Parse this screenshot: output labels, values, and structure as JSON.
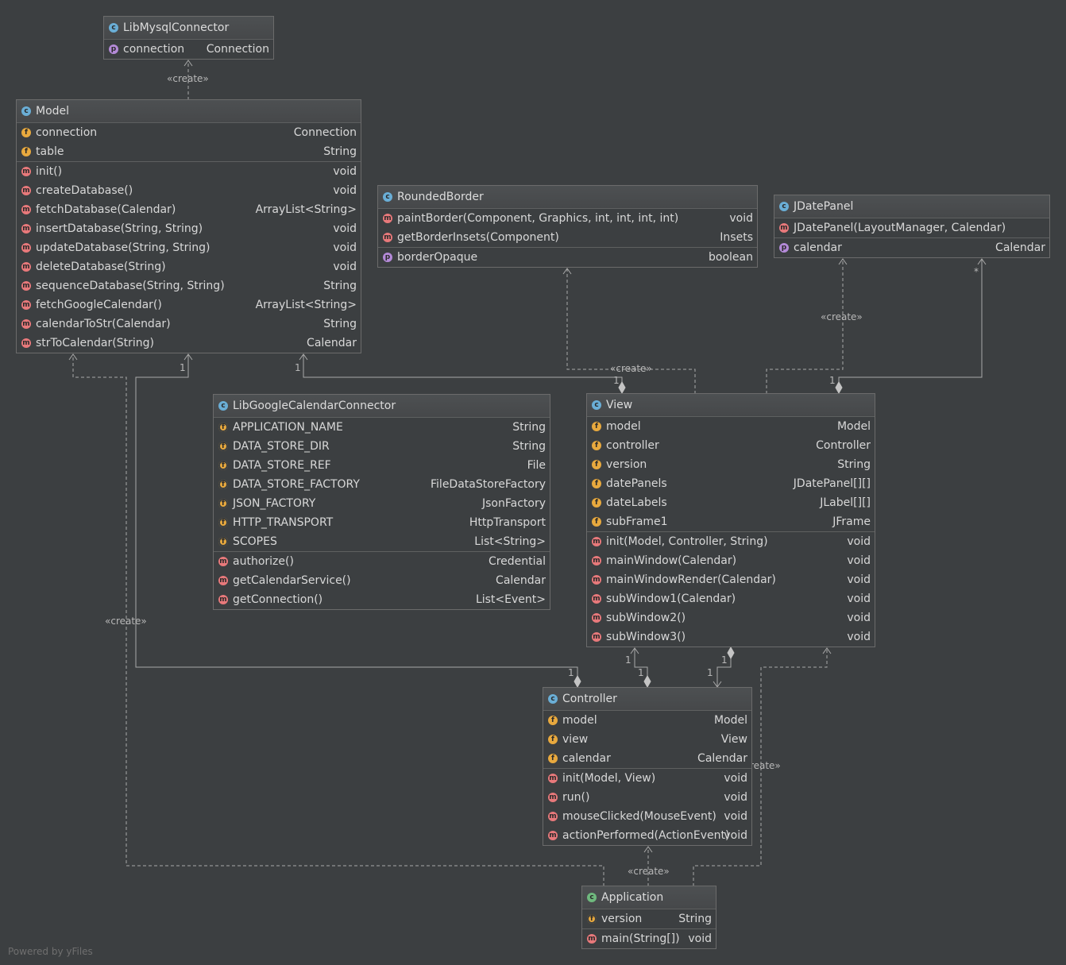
{
  "classes": {
    "libmysql": {
      "name": "LibMysqlConnector",
      "fields": [
        {
          "icon": "p",
          "name": "connection",
          "type": "Connection"
        }
      ],
      "methods": []
    },
    "model": {
      "name": "Model",
      "fields": [
        {
          "icon": "f",
          "name": "connection",
          "type": "Connection"
        },
        {
          "icon": "f",
          "name": "table",
          "type": "String"
        }
      ],
      "methods": [
        {
          "icon": "m",
          "name": "init()",
          "type": "void"
        },
        {
          "icon": "m",
          "name": "createDatabase()",
          "type": "void"
        },
        {
          "icon": "m",
          "name": "fetchDatabase(Calendar)",
          "type": "ArrayList<String>"
        },
        {
          "icon": "m",
          "name": "insertDatabase(String, String)",
          "type": "void"
        },
        {
          "icon": "m",
          "name": "updateDatabase(String, String)",
          "type": "void"
        },
        {
          "icon": "m",
          "name": "deleteDatabase(String)",
          "type": "void"
        },
        {
          "icon": "m",
          "name": "sequenceDatabase(String, String)",
          "type": "String"
        },
        {
          "icon": "m",
          "name": "fetchGoogleCalendar()",
          "type": "ArrayList<String>"
        },
        {
          "icon": "m",
          "name": "calendarToStr(Calendar)",
          "type": "String"
        },
        {
          "icon": "m",
          "name": "strToCalendar(String)",
          "type": "Calendar"
        }
      ]
    },
    "roundedborder": {
      "name": "RoundedBorder",
      "methods": [
        {
          "icon": "m",
          "name": "paintBorder(Component, Graphics, int, int, int, int)",
          "type": "void"
        },
        {
          "icon": "m",
          "name": "getBorderInsets(Component)",
          "type": "Insets"
        }
      ],
      "fields": [
        {
          "icon": "p",
          "name": "borderOpaque",
          "type": "boolean"
        }
      ]
    },
    "jdatepanel": {
      "name": "JDatePanel",
      "methods": [
        {
          "icon": "m",
          "name": "JDatePanel(LayoutManager, Calendar)",
          "type": ""
        }
      ],
      "fields": [
        {
          "icon": "p",
          "name": "calendar",
          "type": "Calendar"
        }
      ]
    },
    "libgoogle": {
      "name": "LibGoogleCalendarConnector",
      "fields": [
        {
          "icon": "sf",
          "name": "APPLICATION_NAME",
          "type": "String"
        },
        {
          "icon": "sf",
          "name": "DATA_STORE_DIR",
          "type": "String"
        },
        {
          "icon": "sf",
          "name": "DATA_STORE_REF",
          "type": "File"
        },
        {
          "icon": "sf",
          "name": "DATA_STORE_FACTORY",
          "type": "FileDataStoreFactory"
        },
        {
          "icon": "sf",
          "name": "JSON_FACTORY",
          "type": "JsonFactory"
        },
        {
          "icon": "sf",
          "name": "HTTP_TRANSPORT",
          "type": "HttpTransport"
        },
        {
          "icon": "sf",
          "name": "SCOPES",
          "type": "List<String>"
        }
      ],
      "methods": [
        {
          "icon": "m",
          "name": "authorize()",
          "type": "Credential"
        },
        {
          "icon": "m",
          "name": "getCalendarService()",
          "type": "Calendar"
        },
        {
          "icon": "m",
          "name": "getConnection()",
          "type": "List<Event>"
        }
      ]
    },
    "view": {
      "name": "View",
      "fields": [
        {
          "icon": "f",
          "name": "model",
          "type": "Model"
        },
        {
          "icon": "f",
          "name": "controller",
          "type": "Controller"
        },
        {
          "icon": "f",
          "name": "version",
          "type": "String"
        },
        {
          "icon": "f",
          "name": "datePanels",
          "type": "JDatePanel[][]"
        },
        {
          "icon": "f",
          "name": "dateLabels",
          "type": "JLabel[][]"
        },
        {
          "icon": "f",
          "name": "subFrame1",
          "type": "JFrame"
        }
      ],
      "methods": [
        {
          "icon": "m",
          "name": "init(Model, Controller, String)",
          "type": "void"
        },
        {
          "icon": "m",
          "name": "mainWindow(Calendar)",
          "type": "void"
        },
        {
          "icon": "m",
          "name": "mainWindowRender(Calendar)",
          "type": "void"
        },
        {
          "icon": "m",
          "name": "subWindow1(Calendar)",
          "type": "void"
        },
        {
          "icon": "m",
          "name": "subWindow2()",
          "type": "void"
        },
        {
          "icon": "m",
          "name": "subWindow3()",
          "type": "void"
        }
      ]
    },
    "controller": {
      "name": "Controller",
      "fields": [
        {
          "icon": "f",
          "name": "model",
          "type": "Model"
        },
        {
          "icon": "f",
          "name": "view",
          "type": "View"
        },
        {
          "icon": "f",
          "name": "calendar",
          "type": "Calendar"
        }
      ],
      "methods": [
        {
          "icon": "m",
          "name": "init(Model, View)",
          "type": "void"
        },
        {
          "icon": "m",
          "name": "run()",
          "type": "void"
        },
        {
          "icon": "m",
          "name": "mouseClicked(MouseEvent)",
          "type": "void"
        },
        {
          "icon": "m",
          "name": "actionPerformed(ActionEvent)",
          "type": "void"
        }
      ]
    },
    "application": {
      "name": "Application",
      "fields": [
        {
          "icon": "sf",
          "name": "version",
          "type": "String"
        }
      ],
      "methods": [
        {
          "icon": "m",
          "name": "main(String[])",
          "type": "void"
        }
      ]
    }
  },
  "edge_labels": {
    "create": "«create»",
    "one": "1",
    "many": "*"
  },
  "footer": "Powered by yFiles"
}
